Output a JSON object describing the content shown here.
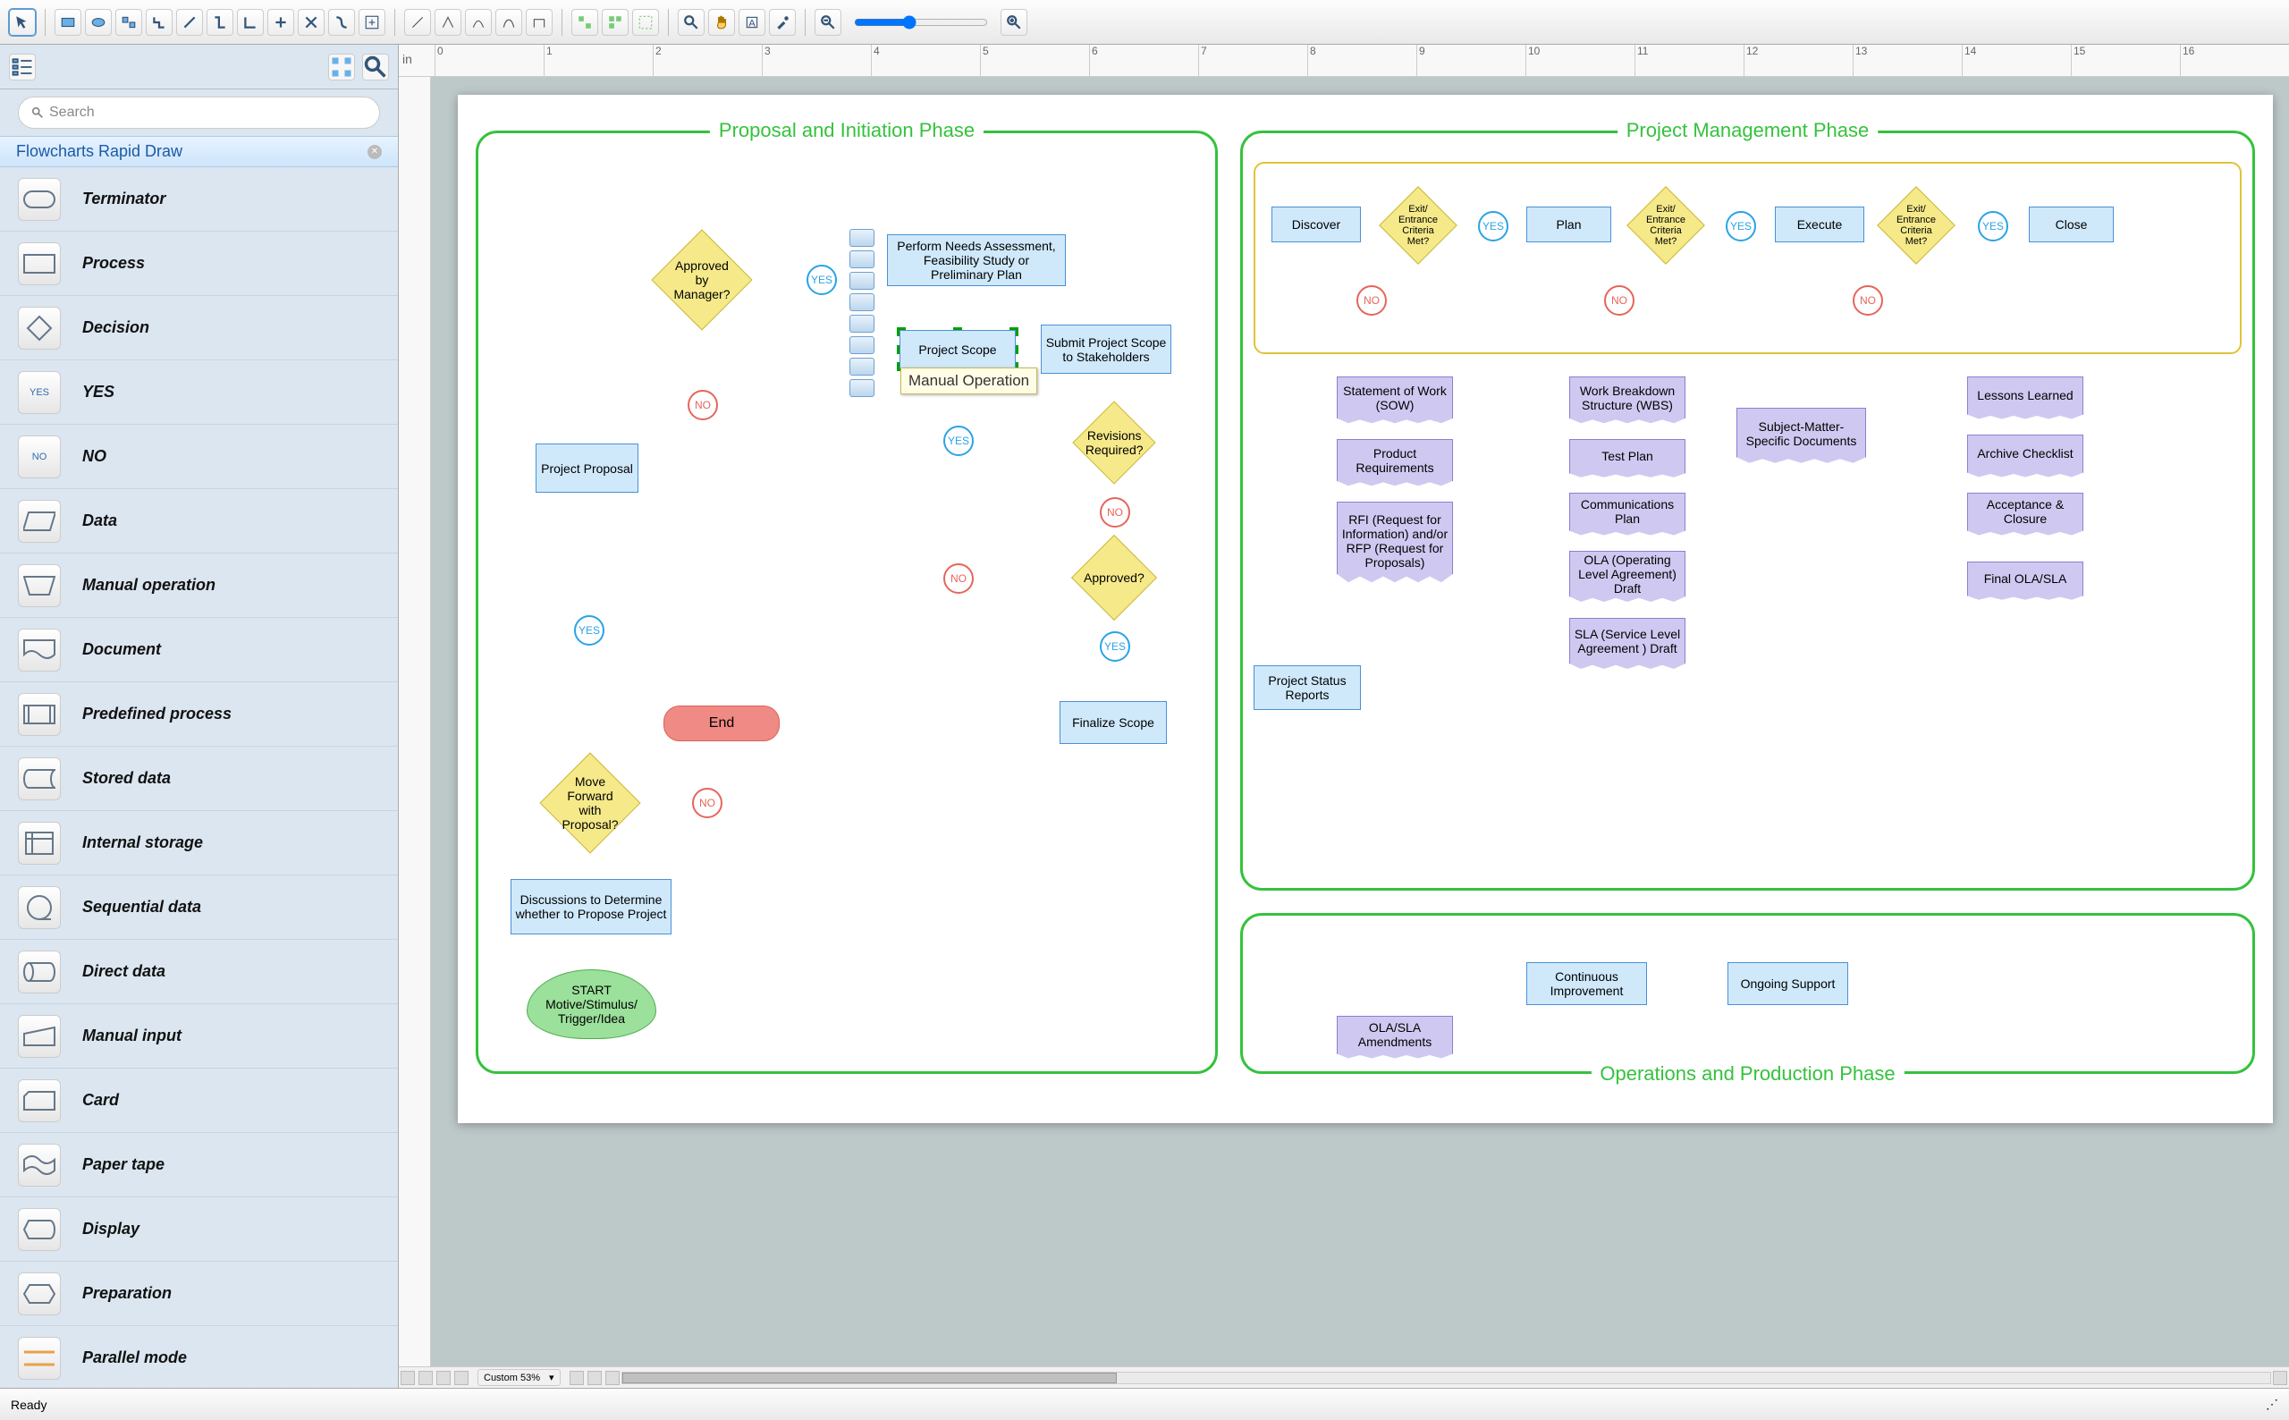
{
  "search_placeholder": "Search",
  "panel_title": "Flowcharts Rapid Draw",
  "ruler_unit": "in",
  "zoom_label": "Custom 53%",
  "status_text": "Ready",
  "selected_tooltip": "Manual Operation",
  "shapes": [
    {
      "label": "Terminator"
    },
    {
      "label": "Process"
    },
    {
      "label": "Decision"
    },
    {
      "label": "YES"
    },
    {
      "label": "NO"
    },
    {
      "label": "Data"
    },
    {
      "label": "Manual operation"
    },
    {
      "label": "Document"
    },
    {
      "label": "Predefined process"
    },
    {
      "label": "Stored data"
    },
    {
      "label": "Internal storage"
    },
    {
      "label": "Sequential data"
    },
    {
      "label": "Direct data"
    },
    {
      "label": "Manual input"
    },
    {
      "label": "Card"
    },
    {
      "label": "Paper tape"
    },
    {
      "label": "Display"
    },
    {
      "label": "Preparation"
    },
    {
      "label": "Parallel mode"
    }
  ],
  "phases": {
    "proposal": "Proposal and Initiation Phase",
    "pm": "Project Management Phase",
    "ops": "Operations and Production Phase"
  },
  "labels": {
    "yes": "YES",
    "no": "NO",
    "end": "End",
    "approved_by_manager": "Approved by Manager?",
    "project_proposal": "Project Proposal",
    "move_forward": "Move Forward with Proposal?",
    "discussions": "Discussions to Determine whether to Propose Project",
    "start": "START Motive/Stimulus/ Trigger/Idea",
    "perform_needs": "Perform Needs Assessment, Feasibility Study or Preliminary Plan",
    "project_scope": "Project Scope",
    "submit_scope": "Submit Project Scope to Stakeholders",
    "revisions": "Revisions Required?",
    "approved": "Approved?",
    "finalize_scope": "Finalize Scope",
    "discover": "Discover",
    "plan": "Plan",
    "execute": "Execute",
    "close": "Close",
    "exit_criteria": "Exit/ Entrance Criteria Met?",
    "sow": "Statement of Work (SOW)",
    "prod_req": "Product Requirements",
    "rfi": "RFI (Request for Information) and/or RFP (Request for Proposals)",
    "status_reports": "Project Status Reports",
    "wbs": "Work Breakdown Structure (WBS)",
    "test_plan": "Test Plan",
    "comm_plan": "Communications Plan",
    "ola_draft": "OLA (Operating Level Agreement) Draft",
    "sla_draft": "SLA (Service Level Agreement ) Draft",
    "sme_docs": "Subject-Matter-Specific Documents",
    "lessons": "Lessons Learned",
    "archive": "Archive Checklist",
    "acceptance": "Acceptance & Closure",
    "final_ola": "Final OLA/SLA",
    "cont_improve": "Continuous Improvement",
    "ongoing_support": "Ongoing Support",
    "ola_amend": "OLA/SLA Amendments"
  },
  "ruler_ticks": [
    "0",
    "1",
    "2",
    "3",
    "4",
    "5",
    "6",
    "7",
    "8",
    "9",
    "10",
    "11",
    "12",
    "13",
    "14",
    "15",
    "16"
  ]
}
